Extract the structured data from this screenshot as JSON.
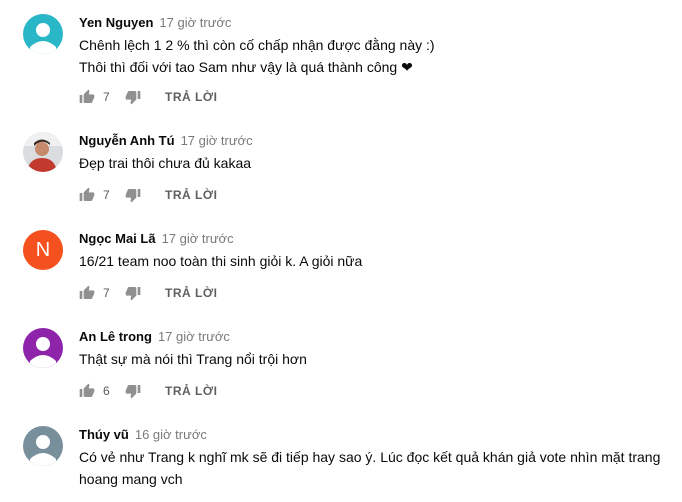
{
  "comments": [
    {
      "author": "Yen Nguyen",
      "time": "17 giờ trước",
      "lines": [
        "Chênh lệch 1 2 % thì còn cố chấp nhận được đằng này :)",
        "Thôi thì đối với tao Sam như vậy là quá thành công ❤"
      ],
      "likes": "7",
      "reply_label": "TRẢ LỜI",
      "avatar": {
        "type": "default",
        "color": "#29b6c6"
      }
    },
    {
      "author": "Nguyễn Anh Tú",
      "time": "17 giờ trước",
      "lines": [
        "Đẹp trai thôi chưa đủ kakaa"
      ],
      "likes": "7",
      "reply_label": "TRẢ LỜI",
      "avatar": {
        "type": "photo",
        "color": "#c23a2e"
      }
    },
    {
      "author": "Ngọc Mai Lã",
      "time": "17 giờ trước",
      "lines": [
        "16/21 team noo toàn thi sinh giỏi k. A giỏi nữa"
      ],
      "likes": "7",
      "reply_label": "TRẢ LỜI",
      "avatar": {
        "type": "letter",
        "letter": "N",
        "color": "#f4511e"
      }
    },
    {
      "author": "An Lê trong",
      "time": "17 giờ trước",
      "lines": [
        "Thật sự mà nói thì Trang nổi trội hơn"
      ],
      "likes": "6",
      "reply_label": "TRẢ LỜI",
      "avatar": {
        "type": "default",
        "color": "#8e24aa"
      }
    },
    {
      "author": "Thúy vũ",
      "time": "16 giờ trước",
      "lines": [
        "Có vẻ như Trang k nghĩ mk sẽ đi tiếp hay sao ý. Lúc đọc kết quả khán giả vote nhìn mặt trang",
        "hoang mang vch"
      ],
      "avatar": {
        "type": "default",
        "color": "#78909c"
      }
    }
  ],
  "icons": {
    "like": "thumbs-up-icon",
    "dislike": "thumbs-down-icon"
  }
}
